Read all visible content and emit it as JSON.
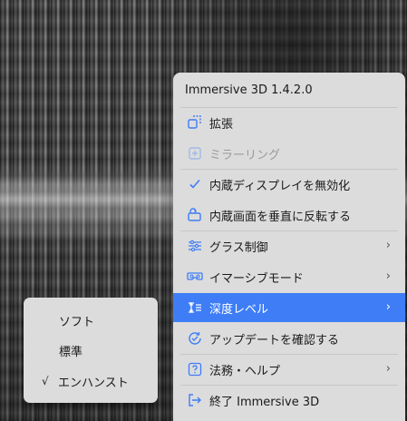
{
  "menu": {
    "title": "Immersive 3D 1.4.2.0",
    "accent_color": "#3e7df6",
    "items": [
      {
        "label": "拡張",
        "icon": "expand-icon",
        "checked": false,
        "disabled": false,
        "submenu": false
      },
      {
        "label": "ミラーリング",
        "icon": "mirror-icon",
        "checked": false,
        "disabled": true,
        "submenu": false
      },
      {
        "label": "内蔵ディスプレイを無効化",
        "icon": "check-icon",
        "checked": true,
        "disabled": false,
        "submenu": false
      },
      {
        "label": "内蔵画面を垂直に反転する",
        "icon": "rotate-screen-icon",
        "checked": false,
        "disabled": false,
        "submenu": false
      },
      {
        "label": "グラス制御",
        "icon": "sliders-icon",
        "checked": false,
        "disabled": false,
        "submenu": true
      },
      {
        "label": "イマーシブモード",
        "icon": "vr-headset-icon",
        "checked": false,
        "disabled": false,
        "submenu": true
      },
      {
        "label": "深度レベル",
        "icon": "depth-icon",
        "checked": false,
        "disabled": false,
        "submenu": true,
        "active": true
      },
      {
        "label": "アップデートを確認する",
        "icon": "update-check-icon",
        "checked": false,
        "disabled": false,
        "submenu": false
      },
      {
        "label": "法務・ヘルプ",
        "icon": "help-icon",
        "checked": false,
        "disabled": false,
        "submenu": true
      },
      {
        "label": "終了 Immersive 3D",
        "icon": "exit-icon",
        "checked": false,
        "disabled": false,
        "submenu": false
      }
    ],
    "submenu_arrow": "›"
  },
  "depth_submenu": {
    "items": [
      {
        "label": "ソフト",
        "checked": false
      },
      {
        "label": "標準",
        "checked": false
      },
      {
        "label": "エンハンスト",
        "checked": true
      }
    ],
    "check_mark": "√"
  }
}
